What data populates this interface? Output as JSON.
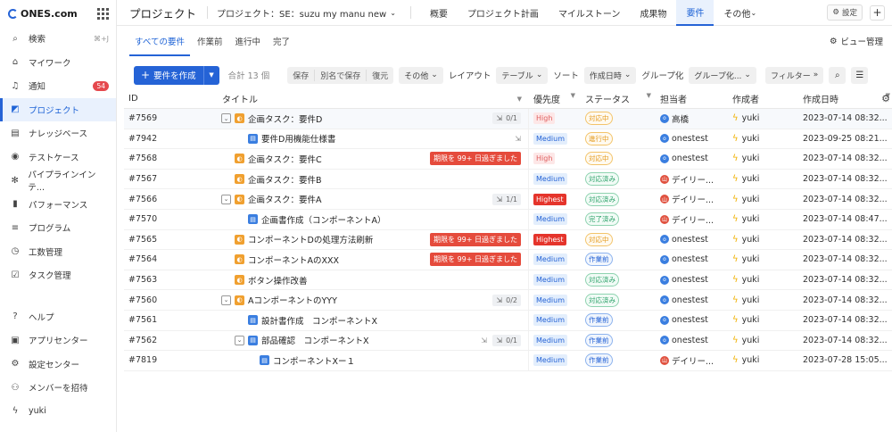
{
  "logo": "ONES.com",
  "sidebar": {
    "items": [
      {
        "label": "検索",
        "icon": "search-icon",
        "glyph": "⌕",
        "shortcut": "⌘+J"
      },
      {
        "label": "マイワーク",
        "icon": "home-icon",
        "glyph": "⌂"
      },
      {
        "label": "通知",
        "icon": "bell-icon",
        "glyph": "♫",
        "badge": "54"
      },
      {
        "label": "プロジェクト",
        "icon": "project-icon",
        "glyph": "◩",
        "active": true
      },
      {
        "label": "ナレッジベース",
        "icon": "doc-icon",
        "glyph": "▤"
      },
      {
        "label": "テストケース",
        "icon": "testcase-icon",
        "glyph": "◉"
      },
      {
        "label": "パイプラインインテ...",
        "icon": "pipeline-icon",
        "glyph": "✻"
      },
      {
        "label": "パフォーマンス",
        "icon": "chart-icon",
        "glyph": "▮"
      },
      {
        "label": "プログラム",
        "icon": "program-icon",
        "glyph": "≡"
      },
      {
        "label": "工数管理",
        "icon": "clock-icon",
        "glyph": "◷"
      },
      {
        "label": "タスク管理",
        "icon": "task-icon",
        "glyph": "☑"
      }
    ],
    "bottom": [
      {
        "label": "ヘルプ",
        "icon": "help-icon",
        "glyph": "?"
      },
      {
        "label": "アプリセンター",
        "icon": "app-center-icon",
        "glyph": "▣"
      },
      {
        "label": "設定センター",
        "icon": "gear-icon",
        "glyph": "⚙"
      },
      {
        "label": "メンバーを招待",
        "icon": "invite-icon",
        "glyph": "⚇"
      },
      {
        "label": "yuki",
        "icon": "user-bolt-icon",
        "glyph": "ϟ"
      }
    ]
  },
  "header": {
    "title": "プロジェクト",
    "project_selector": "プロジェクト：SE：suzu my manu new",
    "tabs": [
      "概要",
      "プロジェクト計画",
      "マイルストーン",
      "成果物",
      "要件",
      "その他"
    ],
    "active_tab": "要件",
    "settings": "設定"
  },
  "subtabs": [
    "すべての要件",
    "作業前",
    "進行中",
    "完了"
  ],
  "view_management": "ビュー管理",
  "toolbar": {
    "create": "要件を作成",
    "total": "合計 13 個",
    "save": "保存",
    "save_as": "別名で保存",
    "restore": "復元",
    "other": "その他",
    "layout_label": "レイアウト",
    "layout_value": "テーブル",
    "sort_label": "ソート",
    "sort_value": "作成日時",
    "group_label": "グループ化",
    "group_value": "グループ化...",
    "filter": "フィルター"
  },
  "columns": [
    "ID",
    "タイトル",
    "優先度",
    "ステータス",
    "担当者",
    "作成者",
    "作成日時"
  ],
  "rows": [
    {
      "id": "#7569",
      "title": "企画タスク：要件D",
      "indent": 1,
      "expand": true,
      "type": "orange",
      "sub": "0/1",
      "priority": "High",
      "status": "対応中",
      "st": "doing",
      "assignee": "高橋",
      "av": "av-blue",
      "creator": "yuki",
      "date": "2023-07-14 08:32..."
    },
    {
      "id": "#7942",
      "title": "要件D用機能仕様書",
      "indent": 2,
      "type": "blue",
      "subicon": true,
      "priority": "Medium",
      "status": "進行中",
      "st": "doing",
      "assignee": "onestest",
      "av": "av-blue",
      "creator": "yuki",
      "date": "2023-09-25 08:21..."
    },
    {
      "id": "#7568",
      "title": "企画タスク：要件C",
      "indent": 1,
      "type": "orange",
      "overdue": "期限を 99+ 日過ぎました",
      "priority": "High",
      "status": "対応中",
      "st": "doing",
      "assignee": "onestest",
      "av": "av-blue",
      "creator": "yuki",
      "date": "2023-07-14 08:32..."
    },
    {
      "id": "#7567",
      "title": "企画タスク：要件B",
      "indent": 1,
      "type": "orange",
      "priority": "Medium",
      "status": "対応済み",
      "st": "done",
      "assignee": "デイリー...",
      "av": "av-red",
      "creator": "yuki",
      "date": "2023-07-14 08:32..."
    },
    {
      "id": "#7566",
      "title": "企画タスク：要件A",
      "indent": 1,
      "expand": true,
      "type": "orange",
      "sub": "1/1",
      "priority": "Highest",
      "status": "対応済み",
      "st": "done",
      "assignee": "デイリー...",
      "av": "av-red",
      "creator": "yuki",
      "date": "2023-07-14 08:32..."
    },
    {
      "id": "#7570",
      "title": "企画書作成（コンポーネントA）",
      "indent": 2,
      "type": "blue",
      "priority": "Medium",
      "status": "完了済み",
      "st": "done",
      "assignee": "デイリー...",
      "av": "av-red",
      "creator": "yuki",
      "date": "2023-07-14 08:47..."
    },
    {
      "id": "#7565",
      "title": "コンポーネントDの処理方法刷新",
      "indent": 1,
      "type": "orange",
      "overdue": "期限を 99+ 日過ぎました",
      "priority": "Highest",
      "status": "対応中",
      "st": "doing",
      "assignee": "onestest",
      "av": "av-blue",
      "creator": "yuki",
      "date": "2023-07-14 08:32..."
    },
    {
      "id": "#7564",
      "title": "コンポーネントAのXXX",
      "indent": 1,
      "type": "orange",
      "overdue": "期限を 99+ 日過ぎました",
      "priority": "Medium",
      "status": "作業前",
      "st": "todo",
      "assignee": "onestest",
      "av": "av-blue",
      "creator": "yuki",
      "date": "2023-07-14 08:32..."
    },
    {
      "id": "#7563",
      "title": "ボタン操作改善",
      "indent": 1,
      "type": "orange",
      "priority": "Medium",
      "status": "対応済み",
      "st": "done",
      "assignee": "onestest",
      "av": "av-blue",
      "creator": "yuki",
      "date": "2023-07-14 08:32..."
    },
    {
      "id": "#7560",
      "title": "AコンポーネントのYYY",
      "indent": 1,
      "expand": true,
      "type": "orange",
      "sub": "0/2",
      "priority": "Medium",
      "status": "対応済み",
      "st": "done",
      "assignee": "onestest",
      "av": "av-blue",
      "creator": "yuki",
      "date": "2023-07-14 08:32..."
    },
    {
      "id": "#7561",
      "title": "設計書作成　コンポーネントX",
      "indent": 2,
      "type": "blue",
      "priority": "Medium",
      "status": "作業前",
      "st": "todo",
      "assignee": "onestest",
      "av": "av-blue",
      "creator": "yuki",
      "date": "2023-07-14 08:32..."
    },
    {
      "id": "#7562",
      "title": "部品確認　コンポーネントX",
      "indent": 2,
      "expand": true,
      "type": "blue",
      "sub": "0/1",
      "subicon": true,
      "priority": "Medium",
      "status": "作業前",
      "st": "todo",
      "assignee": "onestest",
      "av": "av-blue",
      "creator": "yuki",
      "date": "2023-07-14 08:32..."
    },
    {
      "id": "#7819",
      "title": "コンポーネントXー１",
      "indent": 3,
      "type": "blue",
      "priority": "Medium",
      "status": "作業前",
      "st": "todo",
      "assignee": "デイリー...",
      "av": "av-red",
      "creator": "yuki",
      "date": "2023-07-28 15:05..."
    }
  ]
}
